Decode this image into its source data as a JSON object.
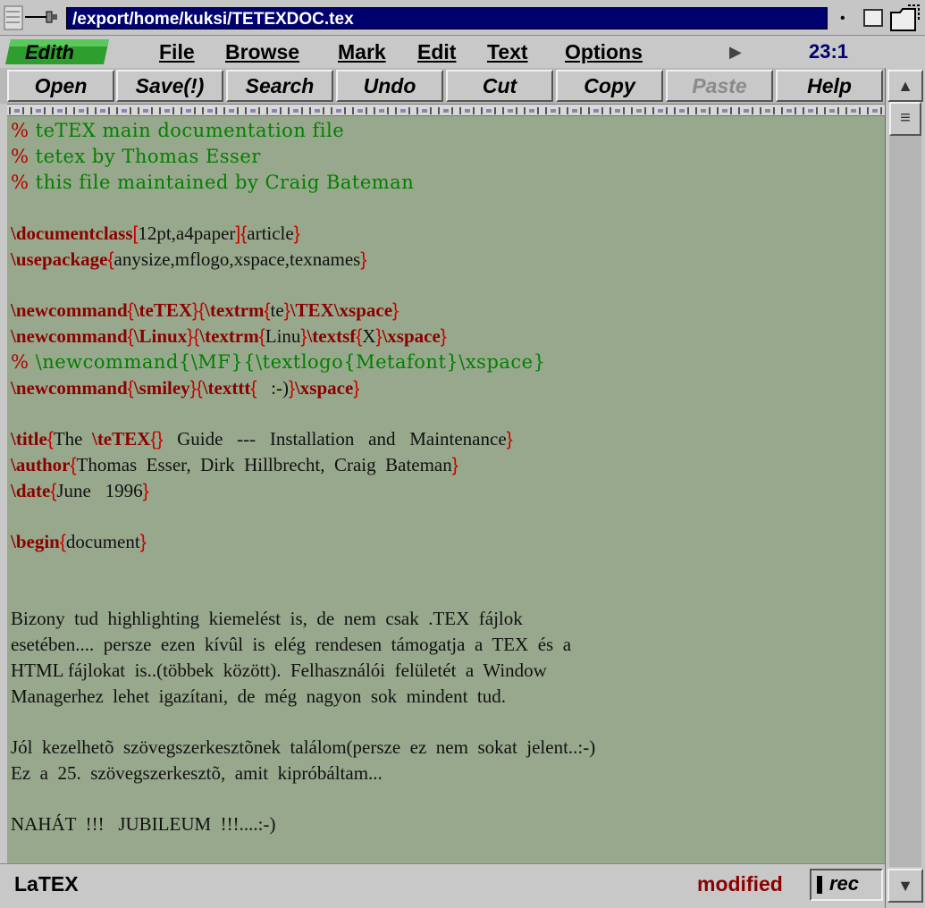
{
  "window": {
    "title": "/export/home/kuksi/TETEXDOC.tex"
  },
  "app": {
    "logo_text": "Edith",
    "position": "23:1"
  },
  "menu": {
    "items": [
      {
        "label": "File"
      },
      {
        "label": "Browse"
      },
      {
        "label": "Mark"
      },
      {
        "label": "Edit"
      },
      {
        "label": "Text"
      },
      {
        "label": "Options"
      }
    ]
  },
  "toolbar": {
    "buttons": [
      {
        "label": "Open",
        "enabled": true
      },
      {
        "label": "Save(!)",
        "enabled": true
      },
      {
        "label": "Search",
        "enabled": true
      },
      {
        "label": "Undo",
        "enabled": true
      },
      {
        "label": "Cut",
        "enabled": true
      },
      {
        "label": "Copy",
        "enabled": true
      },
      {
        "label": "Paste",
        "enabled": false
      },
      {
        "label": "Help",
        "enabled": true
      }
    ]
  },
  "editor": {
    "l1": {
      "pct": "%",
      "text": " teTEX main documentation file"
    },
    "l2": {
      "pct": "%",
      "text": " tetex by Thomas Esser"
    },
    "l3": {
      "pct": "%",
      "text": " this file maintained by Craig Bateman"
    },
    "l4": {
      "kw": "\\documentclass",
      "b1": "[",
      "a1": "12pt,a4paper",
      "b2": "]{",
      "a2": "article",
      "b3": "}"
    },
    "l5": {
      "kw": "\\usepackage",
      "b1": "{",
      "a1": "anysize,mflogo,xspace,texnames",
      "b2": "}"
    },
    "l6": {
      "kw": "\\newcommand",
      "b1": "{",
      "k2": "\\teTEX",
      "b2": "}{",
      "k3": "\\textrm",
      "b3": "{",
      "a1": "te",
      "b4": "}",
      "k4": "\\TEX\\xspace",
      "b5": "}"
    },
    "l7": {
      "kw": "\\newcommand",
      "b1": "{",
      "k2": "\\Linux",
      "b2": "}{",
      "k3": "\\textrm",
      "b3": "{",
      "a1": "Linu",
      "b4": "}",
      "k4": "\\textsf",
      "b5": "{",
      "a2": "X",
      "b6": "}",
      "k5": "\\xspace",
      "b7": "}"
    },
    "l8": {
      "pct": "%",
      "text": " \\newcommand{\\MF}{\\textlogo{Metafont}\\xspace}"
    },
    "l9": {
      "kw": "\\newcommand",
      "b1": "{",
      "k2": "\\smiley",
      "b2": "}{",
      "k3": "\\texttt",
      "b3": "{",
      "a1": "   :-)",
      "b4": "}",
      "k4": "\\xspace",
      "b5": "}"
    },
    "l10": {
      "kw": "\\title",
      "b1": "{",
      "a1": "The  ",
      "k2": "\\teTEX",
      "b2": "{}",
      "a2": "   Guide   ---   Installation   and   Maintenance",
      "b3": "}"
    },
    "l11": {
      "kw": "\\author",
      "b1": "{",
      "a1": "Thomas  Esser,  Dirk  Hillbrecht,  Craig  Bateman",
      "b2": "}"
    },
    "l12": {
      "kw": "\\date",
      "b1": "{",
      "a1": "June   1996",
      "b2": "}"
    },
    "l13": {
      "kw": "\\begin",
      "b1": "{",
      "a1": "document",
      "b2": "}"
    },
    "p1": [
      "Bizony  tud  highlighting  kiemelést  is,  de  nem  csak  .TEX  fájlok",
      "esetében....  persze  ezen  kívûl  is  elég  rendesen  támogatja  a  TEX  és  a",
      "HTML fájlokat  is..(többek  között).  Felhasználói  felületét  a  Window",
      "Managerhez  lehet  igazítani,  de  még  nagyon  sok  mindent  tud."
    ],
    "p2": [
      "Jól  kezelhetõ  szövegszerkesztõnek  találom(persze  ez  nem  sokat  jelent..:-)",
      "Ez  a  25.  szövegszerkesztõ,  amit  kipróbáltam..."
    ],
    "p3": "NAHÁT  !!!   JUBILEUM  !!!....:-)"
  },
  "status": {
    "mode": "LaTEX",
    "modified": "modified",
    "rec": "rec"
  },
  "colors": {
    "editor_bg": "#98a88c",
    "comment": "#008000",
    "keyword": "#8b0000",
    "title_bg": "#00006e"
  }
}
